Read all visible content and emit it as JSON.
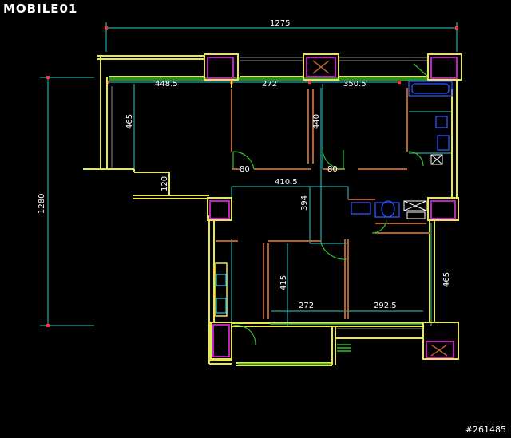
{
  "logo": {
    "text": "MOBILE01"
  },
  "watermark": {
    "text": "#261485"
  },
  "dimensions": {
    "overall_width": "1275",
    "overall_height": "1280",
    "room_a_width": "448.5",
    "room_b_width": "272",
    "room_c_width": "350.5",
    "room_a_depth": "465",
    "room_b_depth": "440",
    "door_a": "80",
    "door_b": "80",
    "balcony_small": "120",
    "living_width": "410.5",
    "living_depth": "394",
    "room_d_depth": "415",
    "room_d_width": "272",
    "room_e_width": "292.5",
    "room_e_depth": "465"
  },
  "colors": {
    "wall": "#e8e84a",
    "dim_line": "#27d0d0",
    "partition": "#b4602a",
    "pillar": "#c020c0",
    "window": "#8a8a8a",
    "balcony": "#2ec02e",
    "fixture": "#2b54ff",
    "text": "#ffffff"
  }
}
